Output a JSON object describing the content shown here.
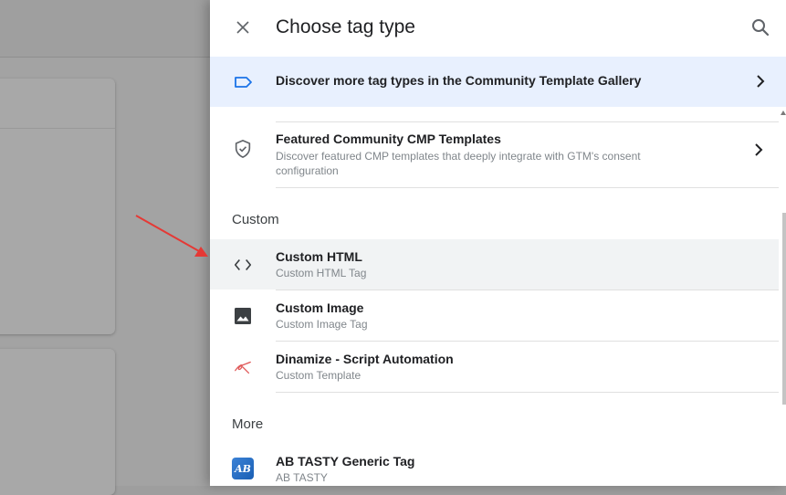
{
  "panel": {
    "title": "Choose tag type"
  },
  "discover_banner": {
    "label": "Discover more tag types in the Community Template Gallery"
  },
  "rows": {
    "featured_cmp": {
      "title": "Featured Community CMP Templates",
      "subtitle_line1": "Discover featured CMP templates that deeply integrate with GTM's consent",
      "subtitle_line2": "configuration"
    },
    "custom_html": {
      "title": "Custom HTML",
      "subtitle": "Custom HTML Tag"
    },
    "custom_image": {
      "title": "Custom Image",
      "subtitle": "Custom Image Tag"
    },
    "dinamize": {
      "title": "Dinamize - Script Automation",
      "subtitle": "Custom Template"
    },
    "ab_tasty": {
      "title": "AB TASTY Generic Tag",
      "subtitle": "AB TASTY",
      "logo_text": "AB"
    }
  },
  "sections": {
    "custom": "Custom",
    "more": "More"
  },
  "colors": {
    "banner_bg": "#e8f0fe",
    "accent_blue": "#1a73e8",
    "arrow_red": "#e53935",
    "highlight_row": "#f1f3f4"
  },
  "icons": {
    "close": "close-icon",
    "search": "search-icon",
    "tag": "tag-outline-icon",
    "shield": "shield-check-icon",
    "code": "code-brackets-icon",
    "image": "image-icon",
    "dinamize": "dinamize-logo-icon",
    "chevron": "chevron-right-icon"
  }
}
